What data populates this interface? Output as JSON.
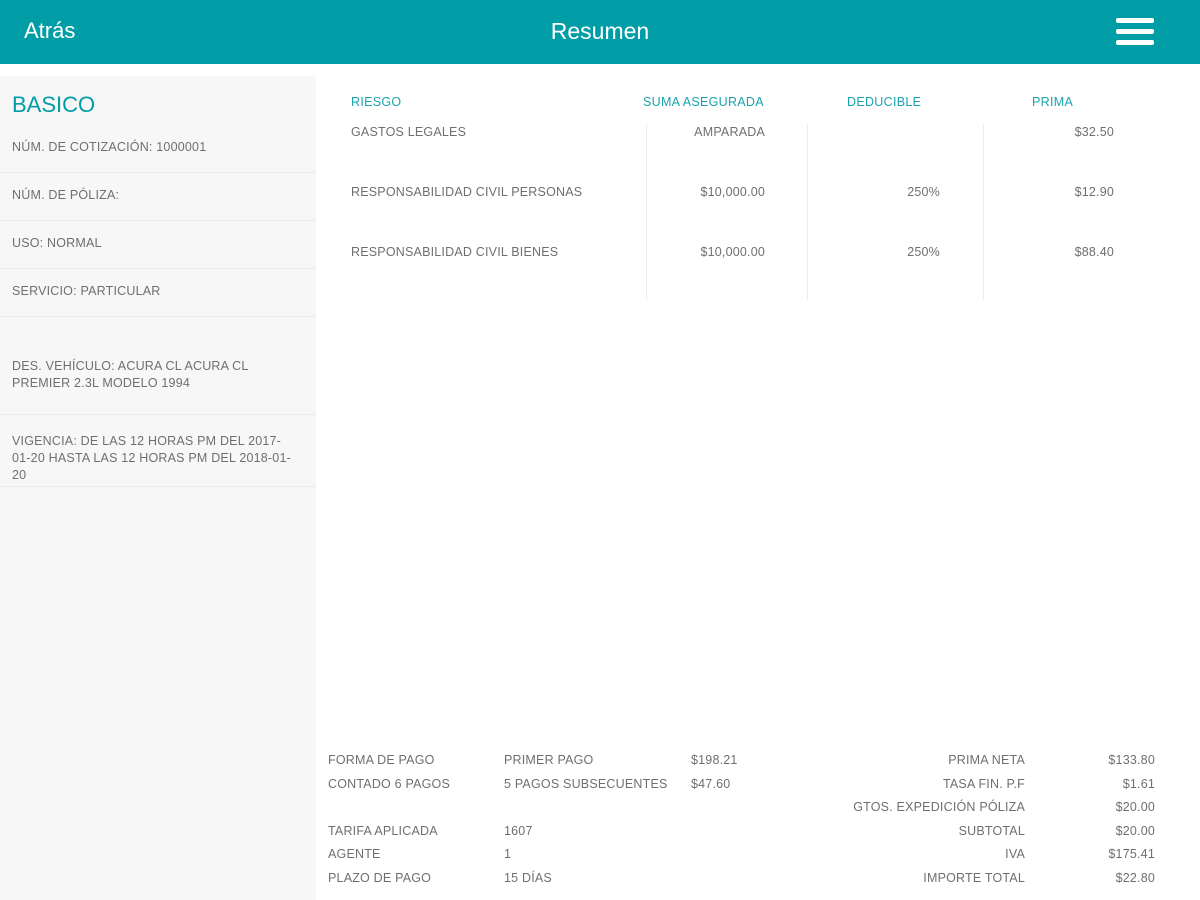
{
  "header": {
    "back_label": "Atrás",
    "title": "Resumen",
    "menu_icon": "hamburger-menu-icon"
  },
  "sidebar": {
    "plan": "BASICO",
    "cotizacion": "NÚM. DE COTIZACIÓN: 1000001",
    "poliza": "NÚM. DE PÓLIZA:",
    "uso": "USO: NORMAL",
    "servicio": "SERVICIO: PARTICULAR",
    "vehiculo": "DES. VEHÍCULO: ACURA CL ACURA CL PREMIER 2.3L MODELO 1994",
    "vigencia": "VIGENCIA: DE LAS 12 HORAS PM DEL 2017-01-20 HASTA LAS 12 HORAS PM DEL 2018-01-20"
  },
  "coverage": {
    "headers": [
      "RIESGO",
      "SUMA ASEGURADA",
      "DEDUCIBLE",
      "PRIMA"
    ],
    "rows": [
      {
        "riesgo": "GASTOS LEGALES",
        "suma": "AMPARADA",
        "deducible": "",
        "prima": "$32.50"
      },
      {
        "riesgo": "RESPONSABILIDAD CIVIL PERSONAS",
        "suma": "$10,000.00",
        "deducible": "250%",
        "prima": "$12.90"
      },
      {
        "riesgo": "RESPONSABILIDAD CIVIL BIENES",
        "suma": "$10,000.00",
        "deducible": "250%",
        "prima": "$88.40"
      }
    ]
  },
  "payment": {
    "forma_label": "FORMA DE PAGO",
    "forma_value": "CONTADO 6 PAGOS",
    "primer_pago_label": "PRIMER PAGO",
    "primer_pago_value": "$198.21",
    "subsecuentes_label": "5 PAGOS SUBSECUENTES",
    "subsecuentes_value": "$47.60",
    "tarifa_label": "TARIFA APLICADA",
    "tarifa_value": "1607",
    "agente_label": "AGENTE",
    "agente_value": "1",
    "plazo_label": "PLAZO DE PAGO",
    "plazo_value": "15 DÍAS"
  },
  "totals": [
    {
      "label": "PRIMA NETA",
      "value": "$133.80"
    },
    {
      "label": "TASA FIN. P.F",
      "value": "$1.61"
    },
    {
      "label": "GTOS. EXPEDICIÓN PÓLIZA",
      "value": "$20.00"
    },
    {
      "label": "SUBTOTAL",
      "value": "$20.00"
    },
    {
      "label": "IVA",
      "value": "$175.41"
    },
    {
      "label": "IMPORTE TOTAL",
      "value": "$22.80"
    }
  ],
  "colors": {
    "accent": "#009da6",
    "sidebar_bg": "#f7f7f7",
    "text": "#6f6f6f"
  }
}
